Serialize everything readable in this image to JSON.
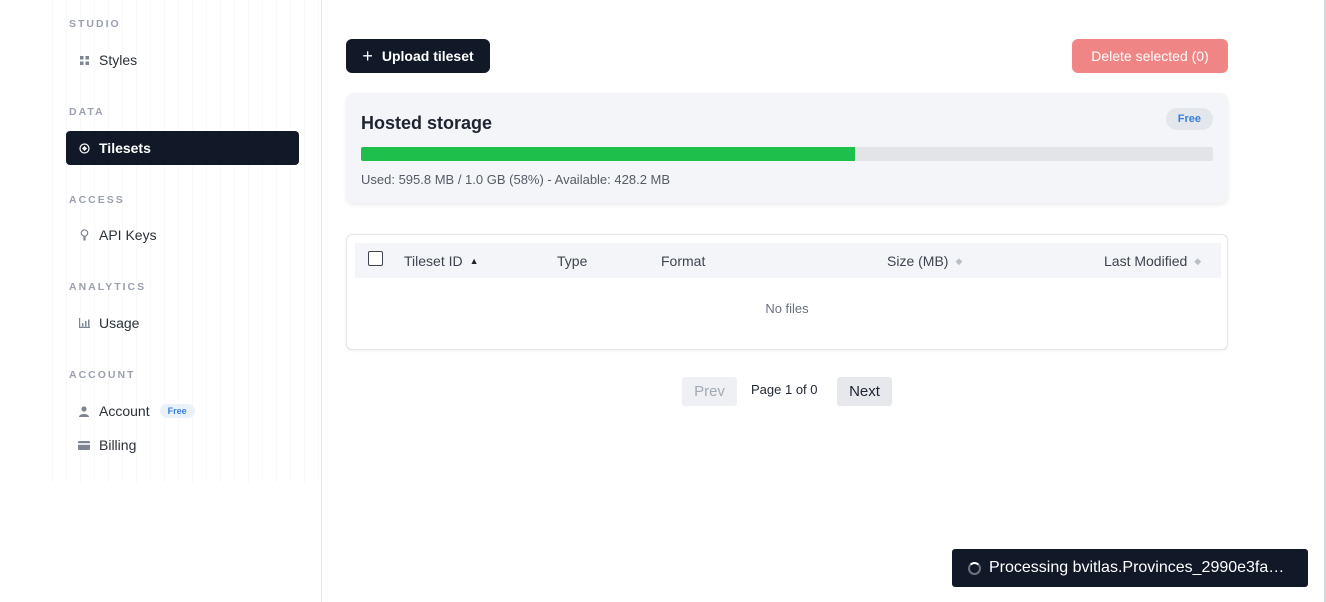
{
  "sidebar": {
    "sections": [
      {
        "label": "STUDIO",
        "items": [
          {
            "label": "Styles",
            "icon": "grid-icon"
          }
        ]
      },
      {
        "label": "DATA",
        "items": [
          {
            "label": "Tilesets",
            "icon": "tileset-icon",
            "active": true
          }
        ]
      },
      {
        "label": "ACCESS",
        "items": [
          {
            "label": "API Keys",
            "icon": "key-icon"
          }
        ]
      },
      {
        "label": "ANALYTICS",
        "items": [
          {
            "label": "Usage",
            "icon": "chart-icon"
          }
        ]
      },
      {
        "label": "ACCOUNT",
        "items": [
          {
            "label": "Account",
            "icon": "user-icon",
            "badge": "Free"
          },
          {
            "label": "Billing",
            "icon": "card-icon"
          }
        ]
      }
    ]
  },
  "toolbar": {
    "upload_label": "Upload tileset",
    "delete_label": "Delete selected (0)"
  },
  "storage": {
    "title": "Hosted storage",
    "badge": "Free",
    "used_fraction": 0.58,
    "usage_text": "Used: 595.8 MB / 1.0 GB (58%) - Available: 428.2 MB"
  },
  "table": {
    "columns": [
      "Tileset ID",
      "Type",
      "Format",
      "Size (MB)",
      "Last Modified"
    ],
    "empty_text": "No files"
  },
  "pagination": {
    "prev_label": "Prev",
    "info": "Page 1 of 0",
    "next_label": "Next"
  },
  "toast": {
    "text": "Processing bvitlas.Provinces_2990e3fa…"
  },
  "colors": {
    "accent_dark": "#111827",
    "danger": "#f08585",
    "progress": "#1fbf4b",
    "badge_text": "#3b7dd8"
  }
}
